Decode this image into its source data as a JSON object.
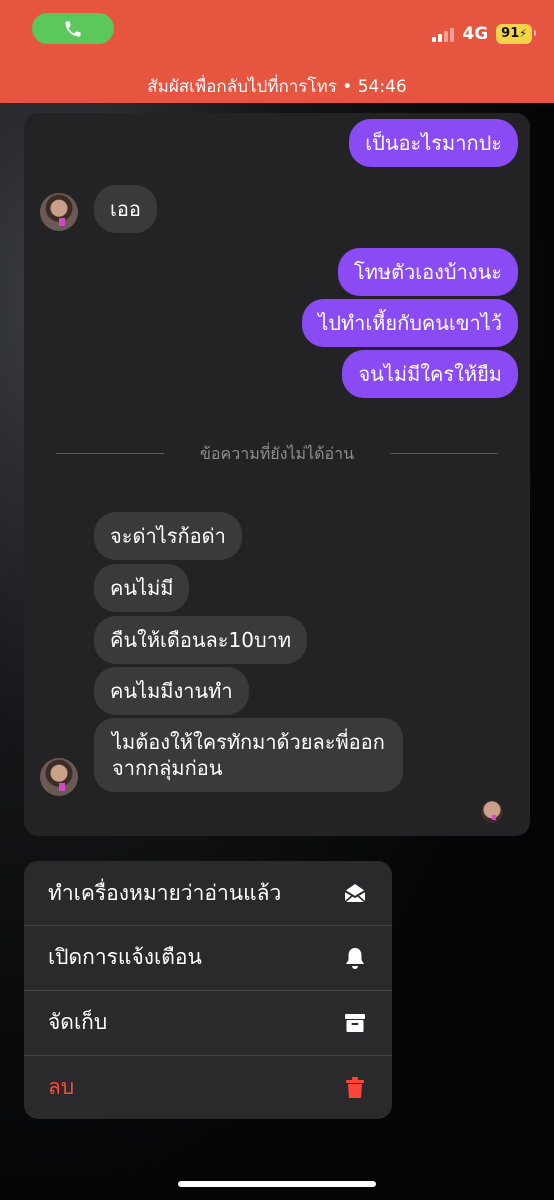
{
  "status_bar": {
    "network": "4G",
    "battery": "91",
    "call_banner": "สัมผัสเพื่อกลับไปที่การโทร • 54:46"
  },
  "chat": {
    "messages": [
      {
        "text": "เป็นอะไรมากปะ",
        "from": "me"
      },
      {
        "text": "เออ",
        "from": "them"
      },
      {
        "text": "โทษตัวเองบ้างนะ",
        "from": "me"
      },
      {
        "text": "ไปทำเหี้ยกับคนเขาไว้",
        "from": "me"
      },
      {
        "text": "จนไม่มีใครให้ยืม",
        "from": "me"
      },
      {
        "text": "จะด่าไรก้อด่า",
        "from": "them"
      },
      {
        "text": "คนไม่มี",
        "from": "them"
      },
      {
        "text": "คืนให้เดือนละ10บาท",
        "from": "them"
      },
      {
        "text": "คนไมมีงานทำ",
        "from": "them"
      },
      {
        "text": "ไมต้องให้ใครทักมาด้วยละพี่ออก",
        "from": "them"
      },
      {
        "text": "จากกลุ่มก่อน",
        "from": "them"
      }
    ],
    "unread_divider": "ข้อความที่ยังไม่ได้อ่าน"
  },
  "menu": {
    "items": [
      {
        "label": "ทำเครื่องหมายว่าอ่านแล้ว",
        "icon": "envelope-open-icon"
      },
      {
        "label": "เปิดการแจ้งเตือน",
        "icon": "bell-icon"
      },
      {
        "label": "จัดเก็บ",
        "icon": "archive-icon"
      },
      {
        "label": "ลบ",
        "icon": "trash-icon"
      }
    ],
    "delete_color": "#ff453a"
  },
  "colors": {
    "status_bar": "#e65540",
    "call_pill": "#5ac85a",
    "outgoing_bubble": "#8a4bf5",
    "incoming_bubble": "#3a3a3c"
  }
}
